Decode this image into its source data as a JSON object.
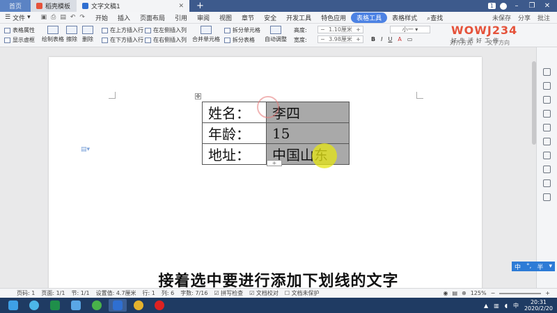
{
  "tabs": [
    {
      "label": "首页"
    },
    {
      "label": "稻壳模板"
    },
    {
      "label": "文字文稿1"
    }
  ],
  "titlebar": {
    "badge": "1"
  },
  "menu": {
    "file": "文件",
    "items": [
      "开始",
      "插入",
      "页面布局",
      "引用",
      "审阅",
      "视图",
      "章节",
      "安全",
      "开发工具",
      "特色应用",
      "表格工具",
      "表格样式"
    ],
    "active": "表格工具",
    "search": "查找",
    "save_status": "未保存",
    "share": "分享",
    "comment": "批注"
  },
  "ribbon": {
    "table_props": "表格属性",
    "show_dashed": "显示虚框",
    "draw_table": "绘制表格",
    "erase": "擦除",
    "delete": "删除",
    "insert_above": "在上方插入行",
    "insert_below": "在下方插入行",
    "insert_left": "在左侧插入列",
    "insert_right": "在右侧插入列",
    "merge_cells": "合并单元格",
    "split_cells": "拆分单元格",
    "split_table": "拆分表格",
    "auto_fit": "自动调整",
    "height_label": "高度:",
    "height_value": "1.10厘米",
    "width_label": "宽度:",
    "width_value": "3.98厘米",
    "font_size": "小一",
    "align_label": "对齐方式",
    "direction_label": "文字方向"
  },
  "table": {
    "rows": [
      {
        "label": "姓名：",
        "value": "李四"
      },
      {
        "label": "年龄：",
        "value": "15"
      },
      {
        "label": "地址：",
        "value": "中国山东"
      }
    ]
  },
  "subtitle": "接着选中要进行添加下划线的文字",
  "ime": {
    "label": "中",
    "mode": "半"
  },
  "status": {
    "page": "页码: 1",
    "pages": "页面: 1/1",
    "section": "节: 1/1",
    "setting": "设置值: 4.7厘米",
    "row": "行: 1",
    "col": "列: 6",
    "words": "字数: 7/16",
    "spell": "拼写检查",
    "proof": "文档校对",
    "unprotected": "文档未保护",
    "zoom": "125%"
  },
  "clock": {
    "time": "20:31",
    "date": "2020/2/20"
  },
  "taskbar": {
    "ime": "中"
  },
  "logo": {
    "text": "WOWJ234",
    "sub": "好生活好工作"
  }
}
